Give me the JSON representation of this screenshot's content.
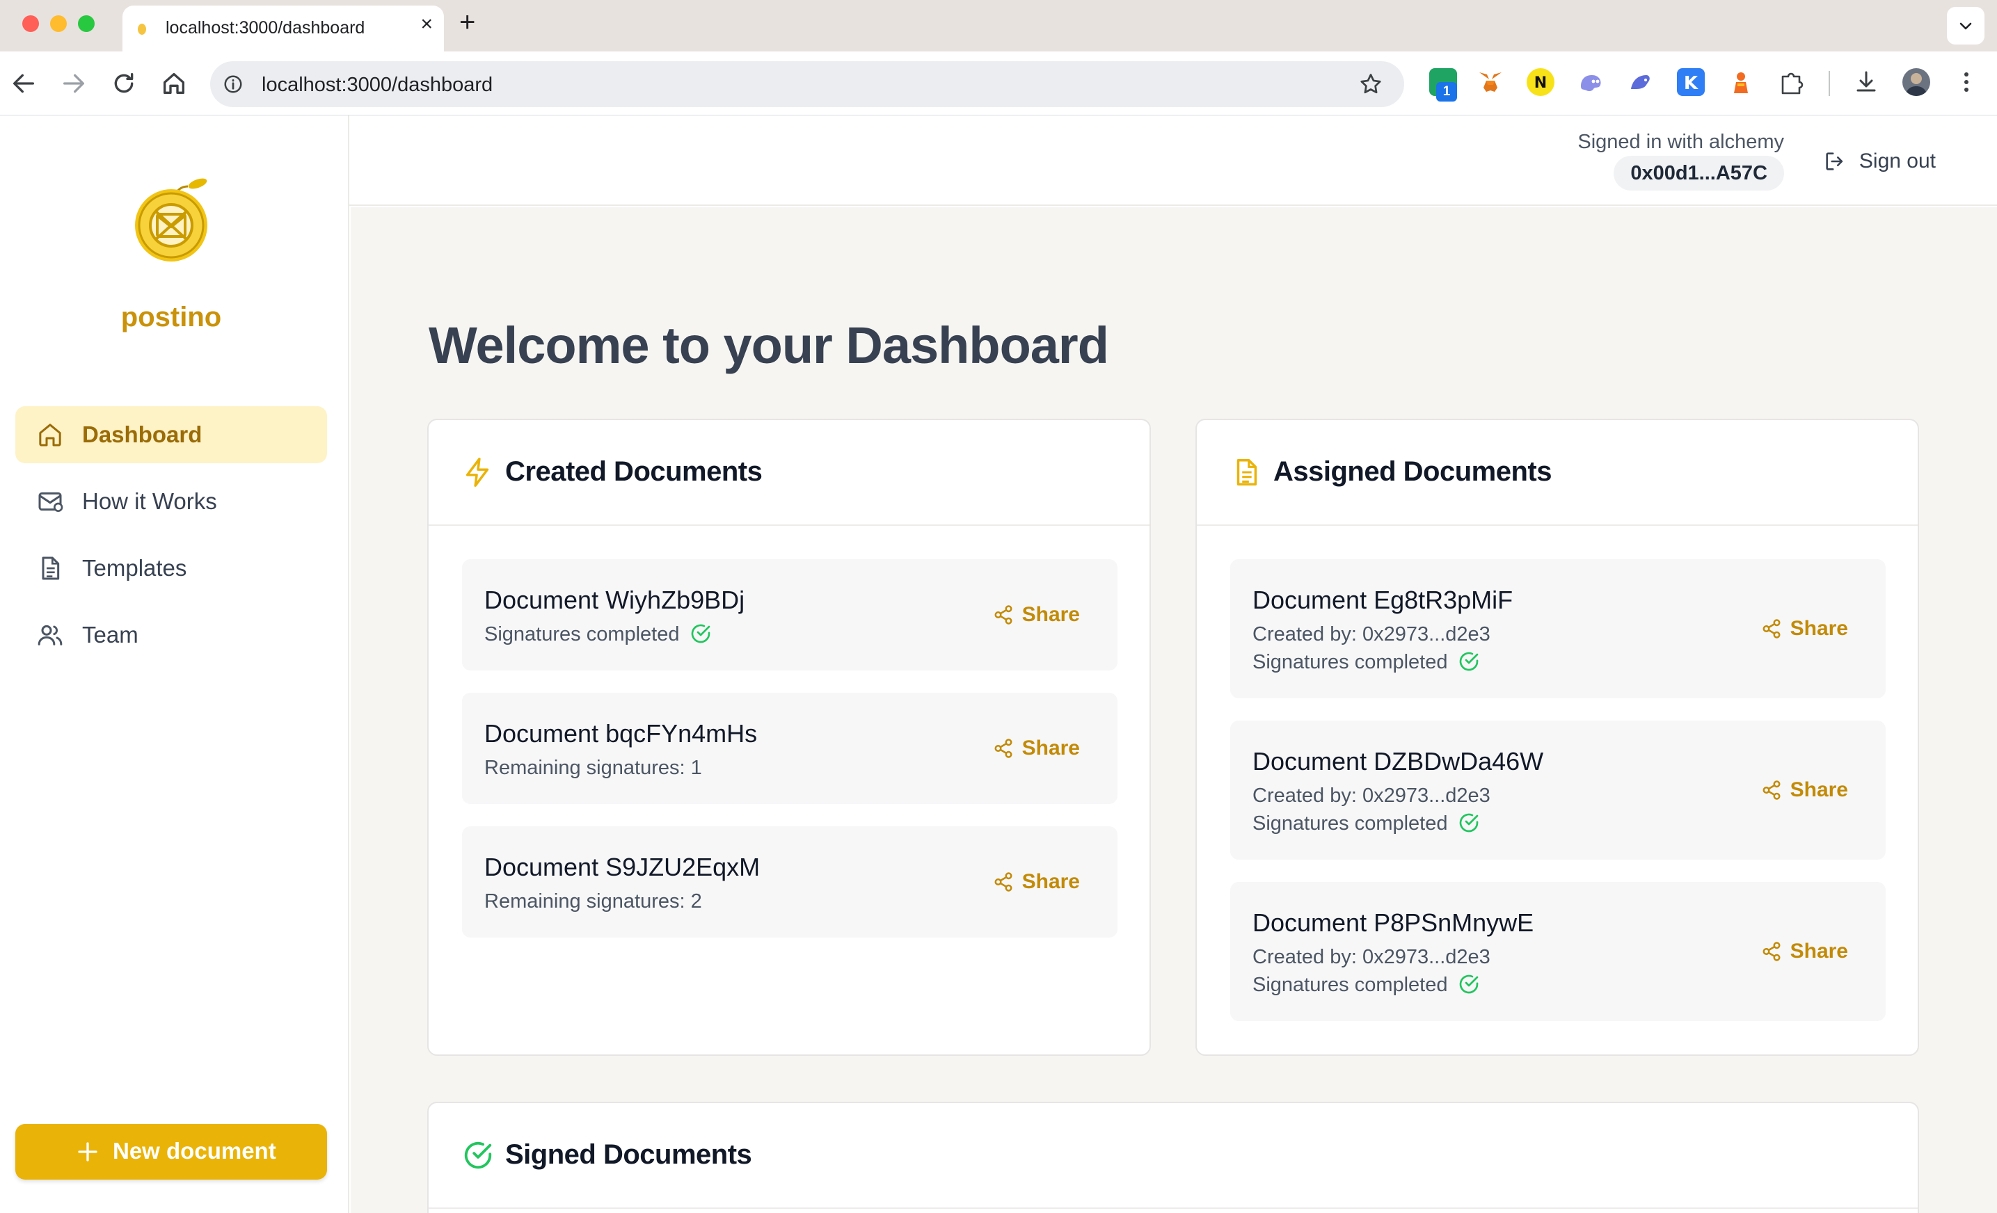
{
  "browser": {
    "tab_title": "localhost:3000/dashboard",
    "url": "localhost:3000/dashboard",
    "extension_badge": "1"
  },
  "header": {
    "signed_in_text": "Signed in with alchemy",
    "address": "0x00d1...A57C",
    "sign_out_label": "Sign out"
  },
  "sidebar": {
    "brand": "postino",
    "items": [
      {
        "label": "Dashboard",
        "icon": "home-icon",
        "active": true
      },
      {
        "label": "How it Works",
        "icon": "mail-icon",
        "active": false
      },
      {
        "label": "Templates",
        "icon": "document-icon",
        "active": false
      },
      {
        "label": "Team",
        "icon": "users-icon",
        "active": false
      }
    ],
    "new_document_label": "New document"
  },
  "main": {
    "title": "Welcome to your Dashboard",
    "created": {
      "title": "Created Documents",
      "icon": "lightning-icon",
      "documents": [
        {
          "name": "Document WiyhZb9BDj",
          "status": "Signatures completed",
          "completed": true,
          "share_label": "Share"
        },
        {
          "name": "Document bqcFYn4mHs",
          "status": "Remaining signatures: 1",
          "completed": false,
          "share_label": "Share"
        },
        {
          "name": "Document S9JZU2EqxM",
          "status": "Remaining signatures: 2",
          "completed": false,
          "share_label": "Share"
        }
      ]
    },
    "assigned": {
      "title": "Assigned Documents",
      "icon": "document-icon",
      "documents": [
        {
          "name": "Document Eg8tR3pMiF",
          "created_by": "Created by: 0x2973...d2e3",
          "status": "Signatures completed",
          "completed": true,
          "share_label": "Share"
        },
        {
          "name": "Document DZBDwDa46W",
          "created_by": "Created by: 0x2973...d2e3",
          "status": "Signatures completed",
          "completed": true,
          "share_label": "Share"
        },
        {
          "name": "Document P8PSnMnywE",
          "created_by": "Created by: 0x2973...d2e3",
          "status": "Signatures completed",
          "completed": true,
          "share_label": "Share"
        }
      ]
    },
    "signed": {
      "title": "Signed Documents",
      "icon": "check-circle-icon"
    }
  },
  "colors": {
    "accent": "#eab308",
    "accent_text": "#c28a06",
    "success": "#22c55e",
    "active_nav_bg": "#fef3c7"
  }
}
